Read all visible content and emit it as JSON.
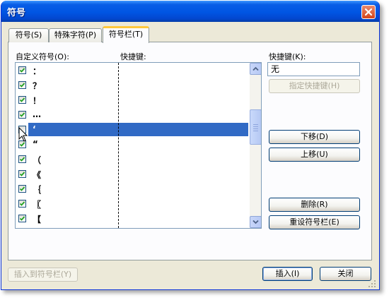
{
  "window": {
    "title": "符号"
  },
  "tabs": [
    {
      "label": "符号(S)"
    },
    {
      "label": "特殊字符(P)"
    },
    {
      "label": "符号栏(T)",
      "active": true
    }
  ],
  "labels": {
    "custom_symbols": "自定义符号(O):",
    "shortcut_column": "快捷键:",
    "shortcut_key": "快捷键(K):"
  },
  "list": {
    "items": [
      {
        "symbol": "：",
        "checked": true
      },
      {
        "symbol": "？",
        "checked": true
      },
      {
        "symbol": "！",
        "checked": true
      },
      {
        "symbol": "…",
        "checked": true
      },
      {
        "symbol": "‘",
        "checked": false,
        "selected": true
      },
      {
        "symbol": "“",
        "checked": true
      },
      {
        "symbol": "（",
        "checked": true
      },
      {
        "symbol": "《",
        "checked": true
      },
      {
        "symbol": "｛",
        "checked": true
      },
      {
        "symbol": "〖",
        "checked": true
      },
      {
        "symbol": "【",
        "checked": true
      }
    ]
  },
  "shortcut": {
    "value": "无"
  },
  "buttons": {
    "assign_shortcut": "指定快捷键(H)",
    "move_down": "下移(D)",
    "move_up": "上移(U)",
    "delete": "删除(R)",
    "reset": "重设符号栏(E)",
    "insert_to_bar": "插入到符号栏(Y)",
    "insert": "插入(I)",
    "close": "关闭"
  },
  "colors": {
    "selection": "#316ac5",
    "titlebar": "#0055e3",
    "dialog_bg": "#ece9d8"
  }
}
